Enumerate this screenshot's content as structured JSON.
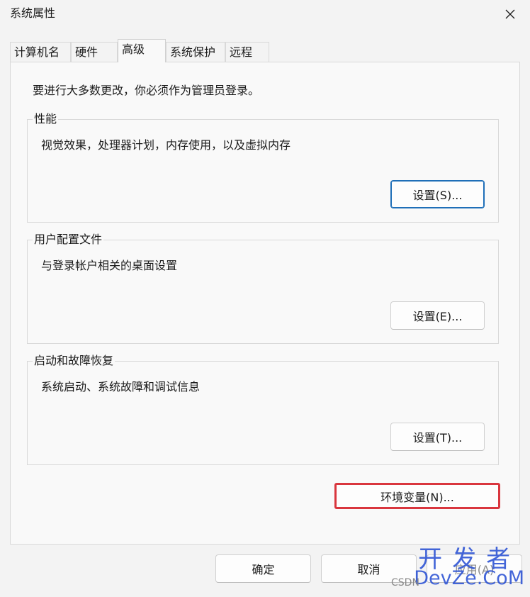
{
  "window": {
    "title": "系统属性"
  },
  "tabs": [
    {
      "label": "计算机名",
      "active": false
    },
    {
      "label": "硬件",
      "active": false
    },
    {
      "label": "高级",
      "active": true
    },
    {
      "label": "系统保护",
      "active": false
    },
    {
      "label": "远程",
      "active": false
    }
  ],
  "notice": "要进行大多数更改，你必须作为管理员登录。",
  "groups": [
    {
      "title": "性能",
      "description": "视觉效果，处理器计划，内存使用，以及虚拟内存",
      "button": "设置(S)..."
    },
    {
      "title": "用户配置文件",
      "description": "与登录帐户相关的桌面设置",
      "button": "设置(E)..."
    },
    {
      "title": "启动和故障恢复",
      "description": "系统启动、系统故障和调试信息",
      "button": "设置(T)..."
    }
  ],
  "env_button": "环境变量(N)...",
  "footer": {
    "ok": "确定",
    "cancel": "取消",
    "apply": "应用(A)"
  },
  "watermark": {
    "top": "开发者",
    "bottom": "DevZe.CoM",
    "csdn": "CSDN"
  },
  "colors": {
    "highlight_border": "#d9363e",
    "focus_border": "#1f6fb8",
    "watermark": "#2f55d4"
  },
  "icons": {
    "close": "close-icon"
  }
}
